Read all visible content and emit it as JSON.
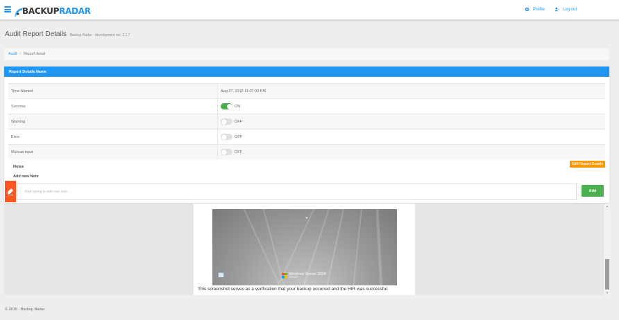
{
  "header": {
    "logo_part1": "BACKUP",
    "logo_part2": "RADAR",
    "profile_label": "Profile",
    "logout_label": "Log out"
  },
  "page": {
    "title": "Audit Report Details",
    "version": "Backup Radar - development ver. 2.1.7"
  },
  "breadcrumb": {
    "items": [
      "Audit",
      "Report detail"
    ]
  },
  "panel": {
    "title": "Report Details Name",
    "rows": [
      {
        "label": "Time Started",
        "value": "Aug 27, 2018 11:07:00 PM"
      },
      {
        "label": "Success",
        "toggle": "ON"
      },
      {
        "label": "Warning",
        "toggle": "OFF"
      },
      {
        "label": "Error",
        "toggle": "OFF"
      },
      {
        "label": "Manual input",
        "toggle": "OFF"
      }
    ],
    "notes_label": "Notes",
    "edit_button": "Edit Report Details",
    "add_note_label": "Add new Note",
    "note_placeholder": "Start typing to add new note...",
    "add_button": "Add"
  },
  "preview": {
    "os_label": "Windows Server 2008",
    "os_edition": "Standard",
    "caption": "This screenshot serves as a verification that your backup occurred and the HIR was successful."
  },
  "footer": {
    "text": "© 2016 - Backup Radar"
  },
  "colors": {
    "primary": "#2196f3",
    "success": "#4caf50",
    "warning": "#ff9800",
    "accent": "#ff5722"
  }
}
